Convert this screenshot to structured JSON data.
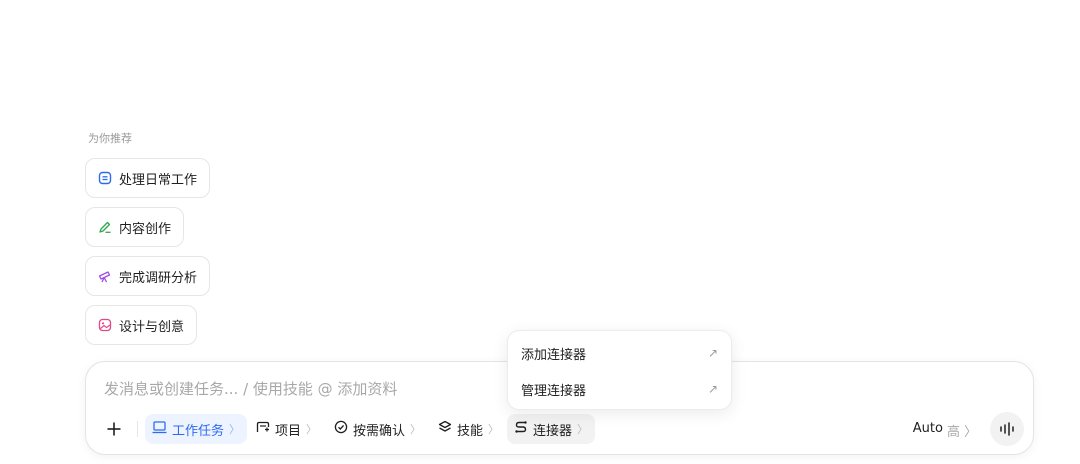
{
  "recommend": {
    "title": "为你推荐",
    "items": [
      {
        "label": "处理日常工作",
        "icon": "daily-work-icon",
        "color": "#2c6bf0"
      },
      {
        "label": "内容创作",
        "icon": "pen-icon",
        "color": "#2fa84f"
      },
      {
        "label": "完成调研分析",
        "icon": "telescope-icon",
        "color": "#a24ee0"
      },
      {
        "label": "设计与创意",
        "icon": "image-icon",
        "color": "#e5488a"
      }
    ]
  },
  "composer": {
    "placeholder": "发消息或创建任务... / 使用技能 @ 添加资料",
    "toolbar": {
      "work_task": "工作任务",
      "project": "项目",
      "confirm": "按需确认",
      "skills": "技能",
      "connectors": "连接器",
      "model": "Auto",
      "level": "高",
      "chevron": "〉"
    }
  },
  "connector_menu": {
    "items": [
      {
        "label": "添加连接器",
        "arrow": "↗"
      },
      {
        "label": "管理连接器",
        "arrow": "↗"
      }
    ]
  },
  "colors": {
    "accent": "#2c6bf0",
    "active_bg": "#eef4ff"
  }
}
